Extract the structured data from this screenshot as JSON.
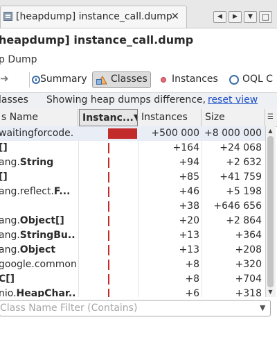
{
  "tab": {
    "title": "[heapdump] instance_call.dump",
    "close_glyph": "✕"
  },
  "nav": {
    "left": "◀",
    "right": "▶",
    "menu": "▼",
    "maximize": "□"
  },
  "page": {
    "title": "heapdump] instance_call.dump",
    "subtitle": "p Dump"
  },
  "toolbar": {
    "back_arrow": "➜",
    "summary_label": "Summary",
    "classes_label": "Classes",
    "instances_label": "Instances",
    "oql_label": "OQL C"
  },
  "infobar": {
    "left_label": "lasses",
    "text": "Showing heap dumps difference,",
    "link": "reset view"
  },
  "table": {
    "columns": {
      "name": "s Name",
      "instances_bar": "Instanc...▼",
      "instances": "Instances",
      "size": "Size",
      "corner": "☰"
    },
    "rows": [
      {
        "name": "waitingforcode.",
        "name_bold": "",
        "instances": "+500 000",
        "size": "+8 000 000",
        "bar": "full"
      },
      {
        "name": "",
        "name_bold": "[]",
        "instances": "+164",
        "size": "+24 068",
        "bar": "tick"
      },
      {
        "name": "ang.",
        "name_bold": "String",
        "instances": "+94",
        "size": "+2 632",
        "bar": "tick"
      },
      {
        "name": "",
        "name_bold": "[]",
        "instances": "+85",
        "size": "+41 759",
        "bar": "tick"
      },
      {
        "name": "ang.reflect.",
        "name_bold": "F...",
        "instances": "+46",
        "size": "+5 198",
        "bar": "tick"
      },
      {
        "name": "",
        "name_bold": "",
        "instances": "+38",
        "size": "+646 656",
        "bar": "tick"
      },
      {
        "name": "ang.",
        "name_bold": "Object[]",
        "instances": "+20",
        "size": "+2 864",
        "bar": "tick"
      },
      {
        "name": "ang.",
        "name_bold": "StringBu...",
        "instances": "+13",
        "size": "+364",
        "bar": "tick"
      },
      {
        "name": "ang.",
        "name_bold": "Object",
        "instances": "+13",
        "size": "+208",
        "bar": "tick"
      },
      {
        "name": "google.common",
        "name_bold": "",
        "instances": "+8",
        "size": "+320",
        "bar": "tick"
      },
      {
        "name": "",
        "name_bold": "C[]",
        "instances": "+8",
        "size": "+704",
        "bar": "tick"
      },
      {
        "name": "nio.",
        "name_bold": "HeapChar...",
        "instances": "+6",
        "size": "+318",
        "bar": "tick"
      }
    ]
  },
  "filter": {
    "placeholder": "Class Name Filter (Contains)",
    "value": "",
    "drop": "▼"
  },
  "scroll": {
    "up": "▲",
    "down": "▼"
  },
  "colors": {
    "bar": "#c32a2a",
    "link": "#1f51c7",
    "selection": "#e9eef6"
  }
}
